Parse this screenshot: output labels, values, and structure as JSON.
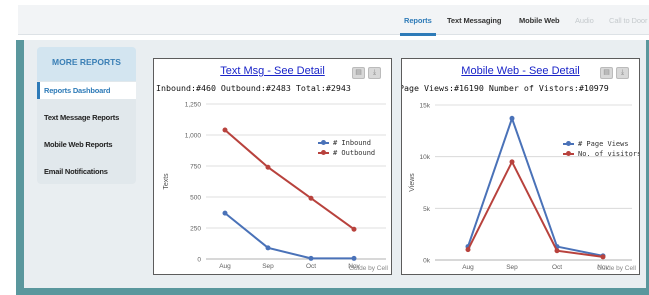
{
  "nav": {
    "tabs": [
      {
        "label": "Reports",
        "state": "active"
      },
      {
        "label": "Text Messaging",
        "state": "normal"
      },
      {
        "label": "Mobile Web",
        "state": "normal"
      },
      {
        "label": "Audio",
        "state": "disabled"
      },
      {
        "label": "Call to Door",
        "state": "disabled"
      }
    ]
  },
  "sidebar": {
    "title": "MORE REPORTS",
    "items": [
      {
        "label": "Reports Dashboard",
        "active": true
      },
      {
        "label": "Text Message Reports",
        "active": false
      },
      {
        "label": "Mobile Web Reports",
        "active": false
      },
      {
        "label": "Email Notifications",
        "active": false
      }
    ]
  },
  "colors": {
    "accent": "#2e7bb8",
    "series_blue": "#4a72b8",
    "series_red": "#b8423d",
    "frame": "#5a979d"
  },
  "chart_data": [
    {
      "type": "line",
      "title": "Text Msg - See Detail",
      "summary": "Inbound:#460 Outbound:#2483 Total:#2943",
      "categories": [
        "Aug",
        "Sep",
        "Oct",
        "Nov"
      ],
      "ylabel": "Texts",
      "ylim": [
        0,
        1250
      ],
      "yticks": [
        0,
        250,
        500,
        750,
        1000,
        1250
      ],
      "ytick_labels": [
        "0",
        "250",
        "500",
        "750",
        "1,000",
        "1,250"
      ],
      "grid": true,
      "legend": "top-right",
      "credit": "Guide by Cell",
      "series": [
        {
          "name": "# Inbound",
          "color": "#4a72b8",
          "values": [
            370,
            90,
            5,
            5
          ]
        },
        {
          "name": "# Outbound",
          "color": "#b8423d",
          "values": [
            1040,
            740,
            490,
            240
          ]
        }
      ]
    },
    {
      "type": "line",
      "title": "Mobile Web - See Detail",
      "summary": "Page Views:#16190 Number of Vistors:#10979",
      "categories": [
        "Aug",
        "Sep",
        "Oct",
        "Nov"
      ],
      "ylabel": "Views",
      "ylim": [
        0,
        15000
      ],
      "yticks": [
        0,
        5000,
        10000,
        15000
      ],
      "ytick_labels": [
        "0k",
        "5k",
        "10k",
        "15k"
      ],
      "grid": true,
      "legend": "top-right",
      "credit": "Guide by Cell",
      "series": [
        {
          "name": "# Page Views",
          "color": "#4a72b8",
          "values": [
            1300,
            13700,
            1300,
            400
          ]
        },
        {
          "name": "No. of visitors",
          "color": "#b8423d",
          "values": [
            1000,
            9500,
            900,
            300
          ]
        }
      ]
    }
  ]
}
